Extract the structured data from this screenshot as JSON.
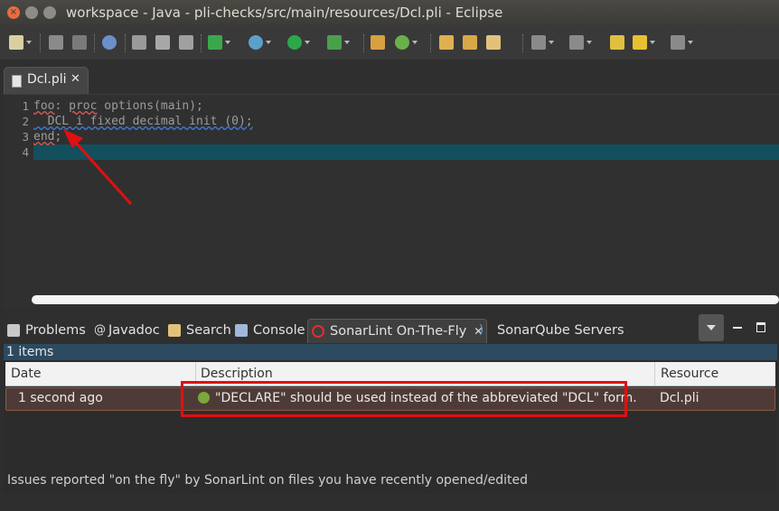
{
  "window": {
    "title": "workspace - Java - pli-checks/src/main/resources/Dcl.pli - Eclipse"
  },
  "editor": {
    "tab_label": "Dcl.pli",
    "tab_close": "✕",
    "line_numbers": [
      "1",
      "2",
      "3",
      "4"
    ],
    "code": {
      "line1_label": "foo",
      "line1_colon": ": ",
      "line1_kw": "proc",
      "line1_rest": " options(main);",
      "line2": "  DCL i fixed decimal init (0);",
      "line3_kw": "end",
      "line3_rest": ";",
      "line4": ""
    }
  },
  "panel": {
    "tabs": {
      "problems": "Problems",
      "javadoc": "Javadoc",
      "search": "Search",
      "console": "Console",
      "sonarlint": "SonarLint On-The-Fly",
      "sonarlint_close": "✕",
      "sonarqube": "SonarQube Servers"
    },
    "items_count": "1 items",
    "columns": {
      "date": "Date",
      "description": "Description",
      "resource": "Resource"
    },
    "rows": [
      {
        "date": "1 second ago",
        "description": "\"DECLARE\" should be used instead of the abbreviated \"DCL\" form.",
        "resource": "Dcl.pli"
      }
    ],
    "status": "Issues reported \"on the fly\" by SonarLint on files you have recently opened/edited"
  },
  "colors": {
    "annotation_red": "#e01010",
    "current_line": "#134f5c",
    "selected_row": "#4e3b37"
  }
}
